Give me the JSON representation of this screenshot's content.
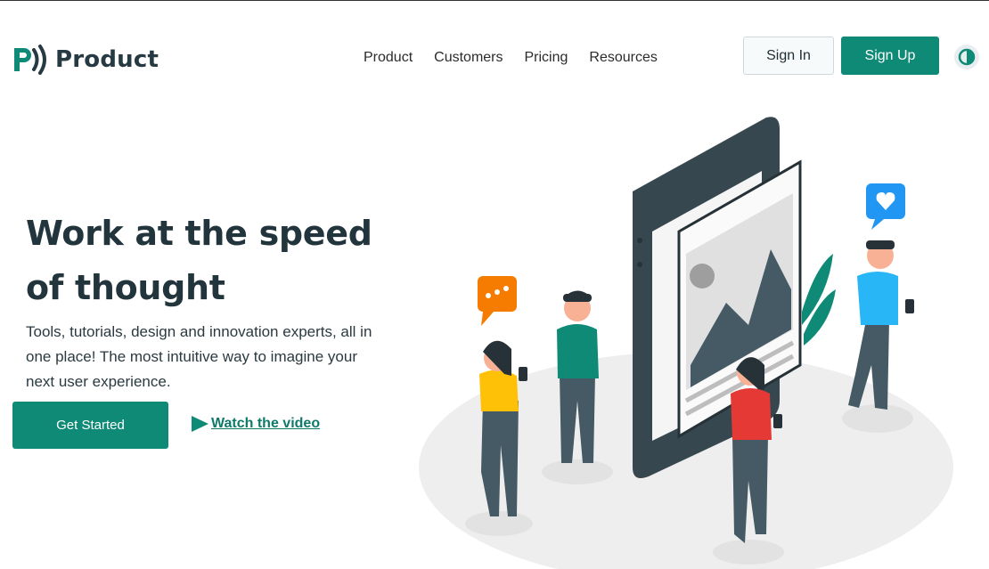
{
  "brand": {
    "name": "Product",
    "accent": "#0f8a76"
  },
  "nav": {
    "items": [
      "Product",
      "Customers",
      "Pricing",
      "Resources"
    ]
  },
  "auth": {
    "sign_in": "Sign In",
    "sign_up": "Sign Up"
  },
  "icons": {
    "theme_toggle": "contrast-icon",
    "play": "play-icon"
  },
  "hero": {
    "title": "Work at the speed of thought",
    "subtitle": "Tools, tutorials, design and innovation experts, all in one place! The most intuitive way to imagine your next user experience.",
    "cta": "Get Started",
    "video_link": "Watch the video"
  }
}
